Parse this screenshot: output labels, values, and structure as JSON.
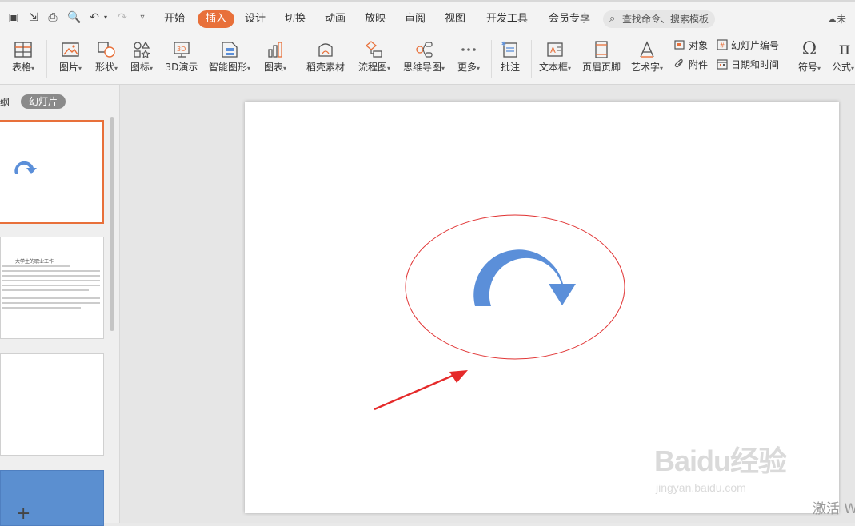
{
  "menubar": {
    "tabs": [
      "开始",
      "插入",
      "设计",
      "切换",
      "动画",
      "放映",
      "审阅",
      "视图",
      "开发工具",
      "会员专享"
    ],
    "active_tab": "插入",
    "search_text": "查找命令、搜索模板",
    "cloud_text": "未"
  },
  "ribbon": {
    "table": "表格",
    "picture": "图片",
    "shape": "形状",
    "icon": "图标",
    "demo3d": "3D演示",
    "smartart": "智能图形",
    "chart": "图表",
    "material": "稻壳素材",
    "flowchart": "流程图",
    "mindmap": "思维导图",
    "more": "更多",
    "comment": "批注",
    "textbox": "文本框",
    "header_footer": "页眉页脚",
    "wordart": "艺术字",
    "object": "对象",
    "attachment": "附件",
    "slide_number": "幻灯片编号",
    "date_time": "日期和时间",
    "symbol": "符号",
    "formula": "公式"
  },
  "left_panel": {
    "outline_tab": "纲",
    "slides_tab": "幻灯片",
    "thumb2_title": "大学生的职业工作",
    "add_slide": "+"
  },
  "watermark": {
    "brand": "Baidu经验",
    "url": "jingyan.baidu.com"
  },
  "activate_text": "激活 W",
  "colors": {
    "accent": "#e8703a",
    "shape_blue": "#5b8fd9",
    "ellipse_red": "#e03030",
    "arrow_red": "#e52a2a"
  }
}
